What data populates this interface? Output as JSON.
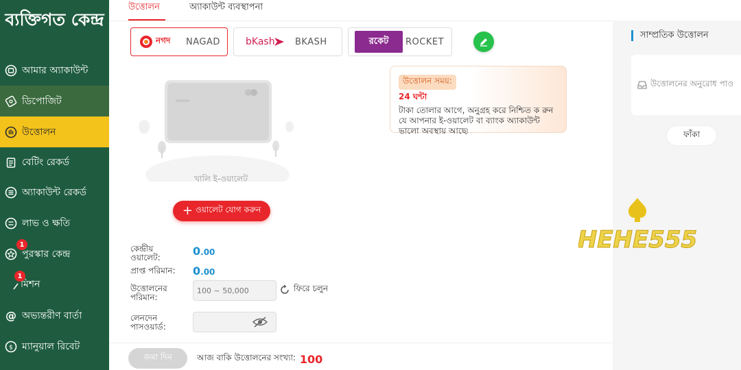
{
  "sidebar": {
    "title": "ব্যক্তিগত কেন্দ্র",
    "items": [
      {
        "label": "আমার অ্যাকাউন্ট",
        "icon": "wallet-icon"
      },
      {
        "label": "ডিপোজিট",
        "icon": "deposit-icon"
      },
      {
        "label": "উত্তোলন",
        "icon": "withdraw-icon",
        "active": true
      },
      {
        "label": "বেটিং রেকর্ড",
        "icon": "clipboard-icon"
      },
      {
        "label": "অ্যাকাউন্ট রেকর্ড",
        "icon": "list-icon"
      },
      {
        "label": "লাভ ও ক্ষতি",
        "icon": "profit-loss-icon"
      },
      {
        "label": "পুরস্কার কেন্দ্র",
        "icon": "gift-icon",
        "badge": "1"
      },
      {
        "label": "মিশন",
        "icon": "mission-icon",
        "badge": "1"
      },
      {
        "label": "অভ্যন্তরীণ বার্তা",
        "icon": "at-icon"
      },
      {
        "label": "ম্যানুয়াল রিবেট",
        "icon": "rebate-icon"
      }
    ]
  },
  "tabs": [
    {
      "label": "উত্তোলন",
      "active": true
    },
    {
      "label": "অ্যাকাউন্ট ব্যবস্থাপনা",
      "active": false
    }
  ],
  "payment_methods": [
    {
      "logo_text": "নগদ",
      "label": "NAGAD",
      "selected": true
    },
    {
      "logo_text": "bKash",
      "label": "BKASH",
      "selected": false
    },
    {
      "logo_text": "রকেট",
      "label": "ROCKET",
      "selected": false
    }
  ],
  "empty_wallet": {
    "text": "খালি ই-ওয়ালেট",
    "add_button": "ওয়ালেট যোগ করুন"
  },
  "notice": {
    "title": "উত্তোলন সময়:",
    "hours": "24 ঘন্টা",
    "description": "টাকা তোলার আগে, অনুগ্রহ করে নিশ্চিত ক রুন যে আপনার ই-ওয়ালেট বা ব্যাংক অ্যাকাউন্ট ভালো অবস্থায় আছে৷"
  },
  "form": {
    "central_wallet_label": "কেন্দ্রীয় ওয়ালেট:",
    "central_wallet_value": "0",
    "central_wallet_decimal": ".00",
    "received_label": "প্রাপ্ত পরিমান:",
    "received_value": "0",
    "received_decimal": ".00",
    "withdraw_amount_label": "উত্তোলনের পরিমান:",
    "withdraw_amount_placeholder": "100 ~ 50,000",
    "back_label": "ফিরে চলুন",
    "password_label": "লেনদেন পাসওয়ার্ড:",
    "password_placeholder": ""
  },
  "bottom": {
    "submit_label": "জমা দিন",
    "remaining_label": "আজ বাকি উত্তোলনের সংখ্যা:",
    "remaining_value": "100"
  },
  "right_panel": {
    "title": "সাম্প্রতিক উত্তোলন",
    "request_text": "উত্তোলনের অনুরোধ পাও",
    "empty_button": "ফাঁকা"
  },
  "watermark": {
    "text": "HEHE555"
  },
  "colors": {
    "sidebar_bg": "#1f5c3f",
    "active_item": "#f3c21b",
    "accent_red": "#e8262b",
    "value_blue": "#1e90d0",
    "edit_green": "#27c24c"
  }
}
